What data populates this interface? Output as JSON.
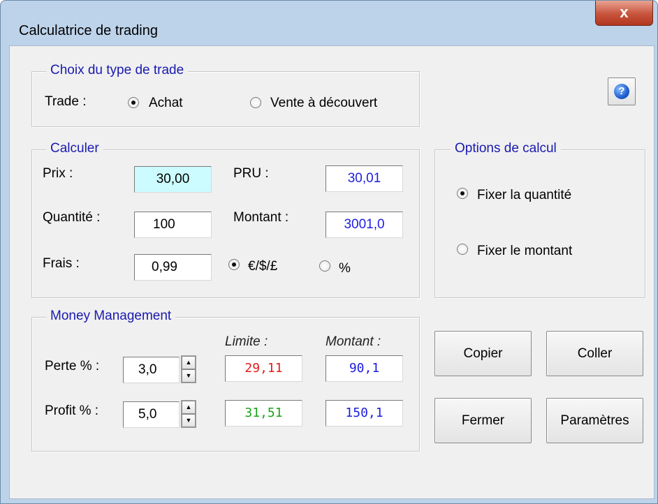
{
  "window": {
    "title": "Calculatrice de trading",
    "close_label": "x"
  },
  "help": {
    "icon": "help-icon",
    "glyph": "?"
  },
  "trade_type": {
    "legend": "Choix du type de trade",
    "label": "Trade :",
    "options": [
      {
        "label": "Achat",
        "selected": true
      },
      {
        "label": "Vente à découvert",
        "selected": false
      }
    ]
  },
  "calculer": {
    "legend": "Calculer",
    "prix_label": "Prix :",
    "prix_value": "30,00",
    "pru_label": "PRU :",
    "pru_value": "30,01",
    "quantite_label": "Quantité :",
    "quantite_value": "100",
    "montant_label": "Montant :",
    "montant_value": "3001,0",
    "frais_label": "Frais :",
    "frais_value": "0,99",
    "frais_units": [
      {
        "label": "€/$/£",
        "selected": true
      },
      {
        "label": "%",
        "selected": false
      }
    ]
  },
  "options_calcul": {
    "legend": "Options de calcul",
    "options": [
      {
        "label": "Fixer la quantité",
        "selected": true
      },
      {
        "label": "Fixer le montant",
        "selected": false
      }
    ]
  },
  "money_management": {
    "legend": "Money Management",
    "limite_header": "Limite :",
    "montant_header": "Montant :",
    "perte_label": "Perte %  :",
    "perte_value": "3,0",
    "perte_limite": "29,11",
    "perte_montant": "90,1",
    "profit_label": "Profit %  :",
    "profit_value": "5,0",
    "profit_limite": "31,51",
    "profit_montant": "150,1"
  },
  "buttons": {
    "copier": "Copier",
    "coller": "Coller",
    "fermer": "Fermer",
    "parametres": "Paramètres"
  },
  "colors": {
    "prix_bg": "#ccfcff",
    "blue_value": "#1d1de0",
    "red_value": "#e51a1a",
    "green_value": "#1aa21a",
    "legend": "#1a1ab0"
  }
}
